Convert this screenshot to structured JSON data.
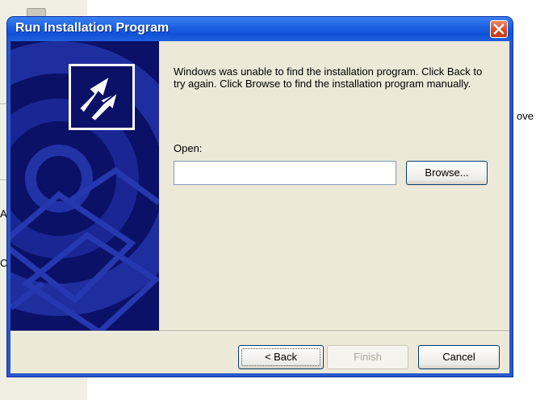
{
  "background": {
    "fragment_right": "ove",
    "fragment_a": "A",
    "fragment_c": "C"
  },
  "dialog": {
    "title": "Run Installation Program",
    "close_icon": "close-icon",
    "message": "Windows was unable to find the installation program.  Click Back to try again.  Click Browse to find the installation program manually.",
    "open_label": "Open:",
    "open_value": "",
    "buttons": {
      "browse": "Browse...",
      "back": "< Back",
      "finish": "Finish",
      "cancel": "Cancel"
    },
    "art_icon": "install-arrow-icon"
  },
  "colors": {
    "title_bar": "#0f51d6",
    "art_background": "#0b1166",
    "dialog_face": "#ece9d8"
  }
}
